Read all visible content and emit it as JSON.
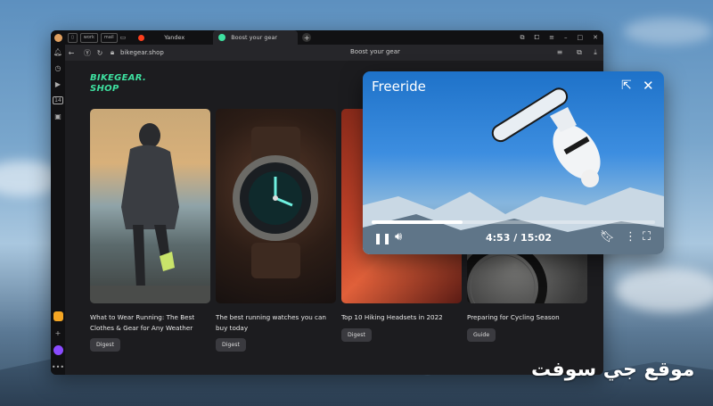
{
  "tabs": [
    {
      "label": "work"
    },
    {
      "label": "mail"
    },
    {
      "label": "Yandex"
    },
    {
      "label": "Boost your gear"
    }
  ],
  "address": {
    "url": "bikegear.shop",
    "page_title": "Boost your gear"
  },
  "site": {
    "logo_line1": "BIKEGEAR.",
    "logo_line2": "SHOP"
  },
  "cards": [
    {
      "title": "What to Wear Running: The Best Clothes & Gear for Any Weather",
      "tag": "Digest"
    },
    {
      "title": "The best running watches you can buy today",
      "tag": "Digest"
    },
    {
      "title": "Top 10 Hiking Headsets in 2022",
      "tag": "Digest"
    },
    {
      "title": "Preparing for Cycling Season",
      "tag": "Guide"
    }
  ],
  "video": {
    "title": "Freeride",
    "time": "4:53 / 15:02",
    "progress": 0.32
  },
  "watermark": "موقع جي سوفت",
  "colors": {
    "accent": "#3ee0a0",
    "yandex_red": "#fc3f1d",
    "active_tab_dot": "#3ee0a0"
  }
}
